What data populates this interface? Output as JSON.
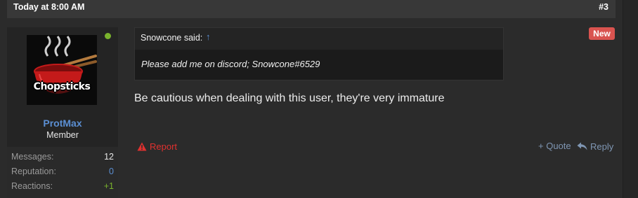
{
  "post": {
    "date": "Today at 8:00 AM",
    "number": "#3",
    "badge": "New",
    "body": "Be cautious when dealing with this user, they're very immature"
  },
  "user": {
    "name": "ProtMax",
    "title": "Member",
    "avatar_text": "Chopsticks",
    "online_color": "#7ab32d",
    "stats": [
      {
        "label": "Messages:",
        "value": "12"
      },
      {
        "label": "Reputation:",
        "value": "0"
      },
      {
        "label": "Reactions:",
        "value": "+1"
      }
    ]
  },
  "quote": {
    "author": "Snowcone said:",
    "jump_icon": "↑",
    "text": "Please add me on discord; Snowcone#6529"
  },
  "actions": {
    "report": "Report",
    "quote": "+ Quote",
    "reply": "Reply"
  },
  "colors": {
    "accent": "#5b8fd3",
    "report": "#e0312f",
    "new_badge": "#d9534f"
  }
}
